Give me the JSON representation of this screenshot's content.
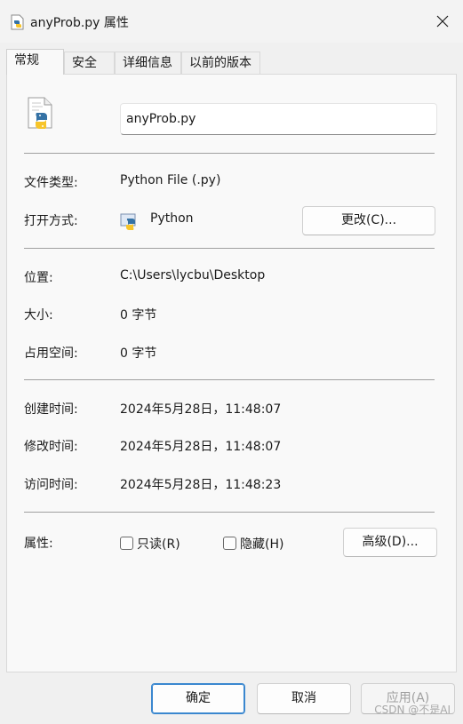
{
  "window": {
    "title": "anyProb.py 属性"
  },
  "tabs": [
    {
      "label": "常规"
    },
    {
      "label": "安全"
    },
    {
      "label": "详细信息"
    },
    {
      "label": "以前的版本"
    }
  ],
  "general": {
    "filename": "anyProb.py",
    "file_type_label": "文件类型:",
    "file_type_value": "Python File (.py)",
    "open_with_label": "打开方式:",
    "open_with_value": "Python",
    "change_button": "更改(C)...",
    "location_label": "位置:",
    "location_value": "C:\\Users\\lycbu\\Desktop",
    "size_label": "大小:",
    "size_value": "0 字节",
    "size_on_disk_label": "占用空间:",
    "size_on_disk_value": "0 字节",
    "created_label": "创建时间:",
    "created_value": "2024年5月28日，11:48:07",
    "modified_label": "修改时间:",
    "modified_value": "2024年5月28日，11:48:07",
    "accessed_label": "访问时间:",
    "accessed_value": "2024年5月28日，11:48:23",
    "attributes_label": "属性:",
    "readonly_label": "只读(R)",
    "readonly_checked": false,
    "hidden_label": "隐藏(H)",
    "hidden_checked": false,
    "advanced_button": "高级(D)..."
  },
  "footer": {
    "ok": "确定",
    "cancel": "取消",
    "apply": "应用(A)"
  },
  "watermark": "CSDN @不是AI",
  "icons": [
    "python-file-icon",
    "python-app-icon",
    "close-icon"
  ],
  "colors": {
    "accent": "#3a87cf",
    "panel": "#f9f9f9",
    "window": "#f0f0f0"
  }
}
